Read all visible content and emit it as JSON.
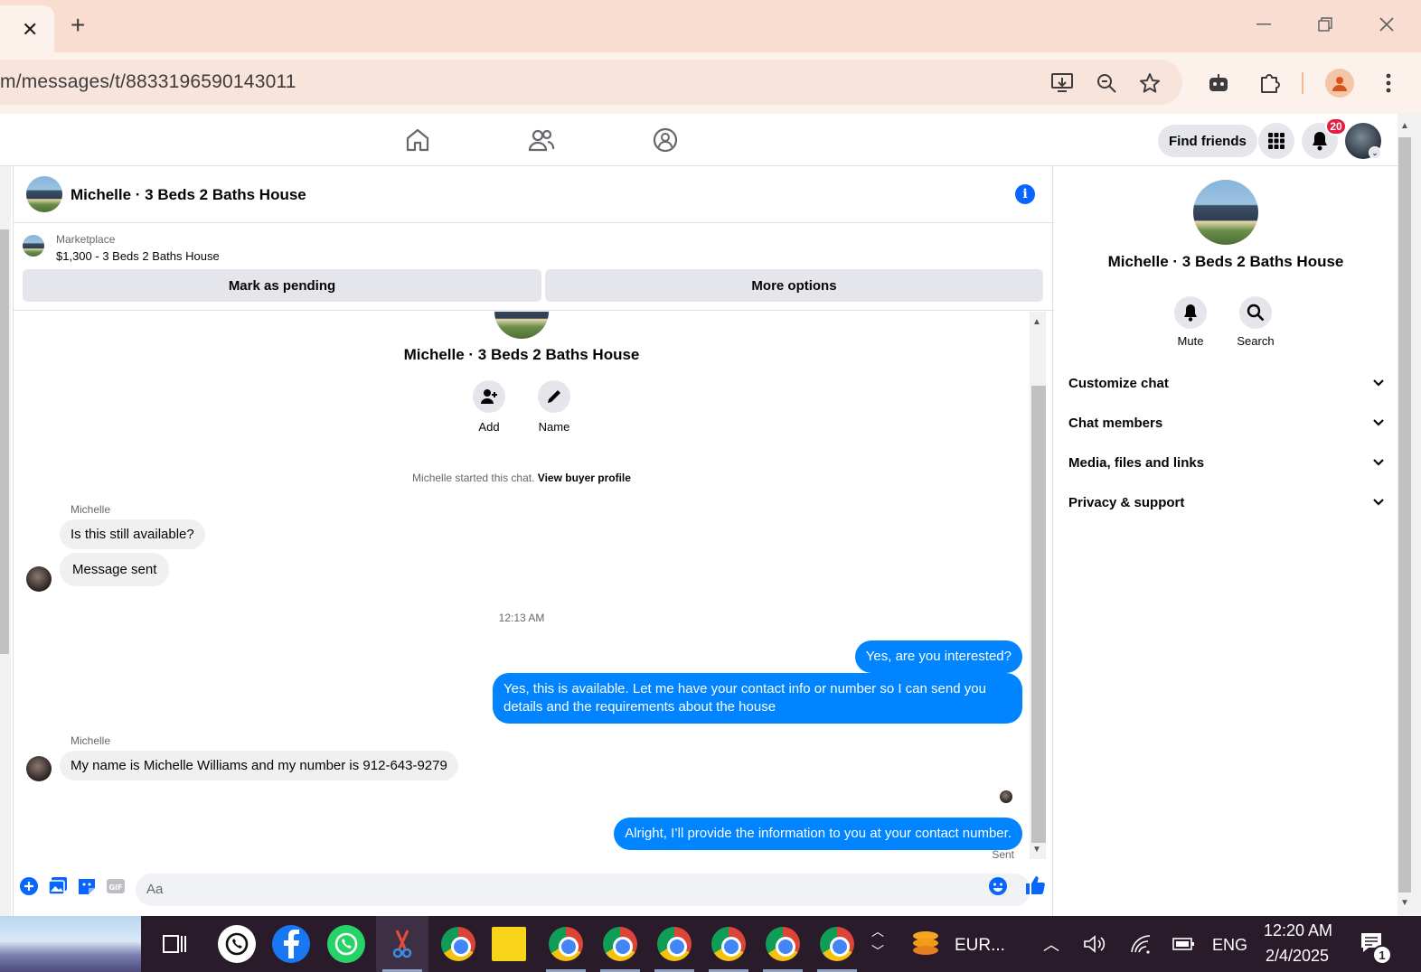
{
  "browser": {
    "url": "m/messages/t/8833196590143011"
  },
  "fbnav": {
    "find_friends": "Find friends",
    "notification_count": "20"
  },
  "chat": {
    "title": "Michelle · 3 Beds 2 Baths House",
    "marketplace_label": "Marketplace",
    "listing": "$1,300 - 3 Beds 2 Baths House",
    "mark_pending": "Mark as pending",
    "more_options": "More options",
    "center_name": "Michelle · 3 Beds 2 Baths House",
    "add_label": "Add",
    "name_label": "Name",
    "started_text": "Michelle started this chat.",
    "view_buyer": "View buyer profile",
    "messages": [
      {
        "sender": "Michelle",
        "direction": "in",
        "text": "Is this still available?"
      },
      {
        "direction": "in",
        "text": "Message sent"
      },
      {
        "timestamp": "12:13 AM"
      },
      {
        "direction": "out",
        "text": "Yes, are you interested?"
      },
      {
        "direction": "out",
        "text": "Yes, this is available. Let me have your contact info or number so I can send you details and the requirements about the house"
      },
      {
        "sender": "Michelle",
        "direction": "in",
        "text": "My name is Michelle Williams and my number is 912-643-9279"
      },
      {
        "direction": "out",
        "text": "Alright, I’ll provide the information to you at your contact number."
      }
    ],
    "sent_status": "Sent",
    "composer_placeholder": "Aa"
  },
  "info_panel": {
    "name": "Michelle · 3 Beds 2 Baths House",
    "mute": "Mute",
    "search": "Search",
    "sections": [
      "Customize chat",
      "Chat members",
      "Media, files and links",
      "Privacy & support"
    ]
  },
  "taskbar": {
    "weather_text": "EUR...",
    "language": "ENG",
    "time": "12:20 AM",
    "date": "2/4/2025",
    "notif_count": "1"
  },
  "colors": {
    "accent": "#0866ff",
    "outgoing_bubble": "#0084ff",
    "badge": "#e41e3f"
  }
}
